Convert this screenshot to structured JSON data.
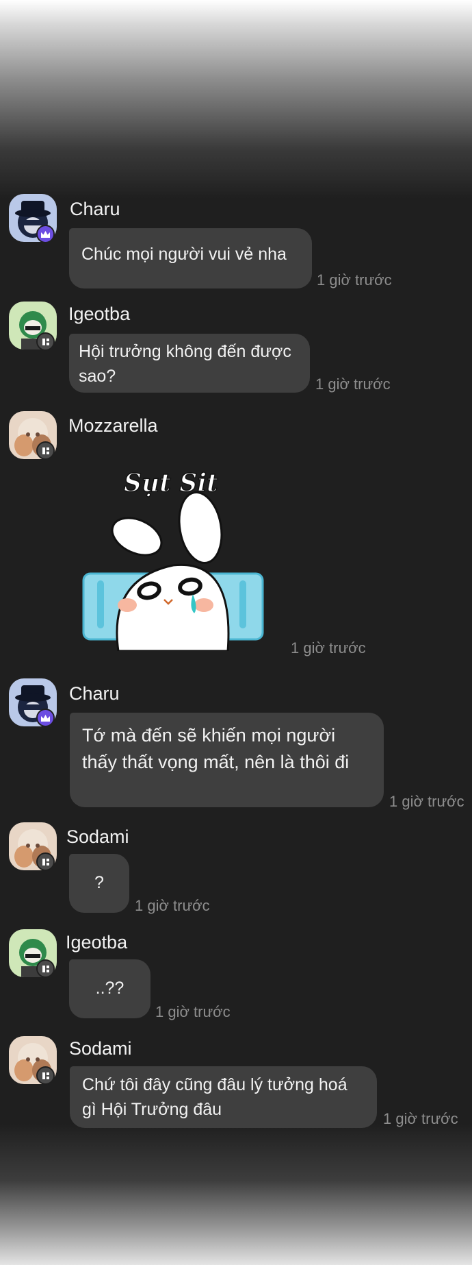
{
  "messages": [
    {
      "user": "Charu",
      "text": "Chúc mọi người vui vẻ nha",
      "time": "1 giờ trước"
    },
    {
      "user": "Igeotba",
      "text": "Hội trưởng không đến được sao?",
      "time": "1 giờ trước"
    },
    {
      "user": "Mozzarella",
      "sticker_text": "Sụt Sịt",
      "time": "1 giờ trước"
    },
    {
      "user": "Charu",
      "text": "Tớ mà đến sẽ khiến mọi người thấy thất vọng mất, nên là thôi đi",
      "time": "1 giờ trước"
    },
    {
      "user": "Sodami",
      "text": "?",
      "time": "1 giờ trước"
    },
    {
      "user": "Igeotba",
      "text": "..??",
      "time": "1 giờ trước"
    },
    {
      "user": "Sodami",
      "text": "Chứ tôi đây cũng đâu lý tưởng hoá gì Hội Trưởng đâu",
      "time": "1 giờ trước"
    }
  ],
  "colors": {
    "background": "#1f1f1f",
    "bubble": "#3f3f3f",
    "text": "#f2f2f2",
    "timestamp": "#8e8e8e",
    "crown_badge": "#6c4ee2"
  }
}
